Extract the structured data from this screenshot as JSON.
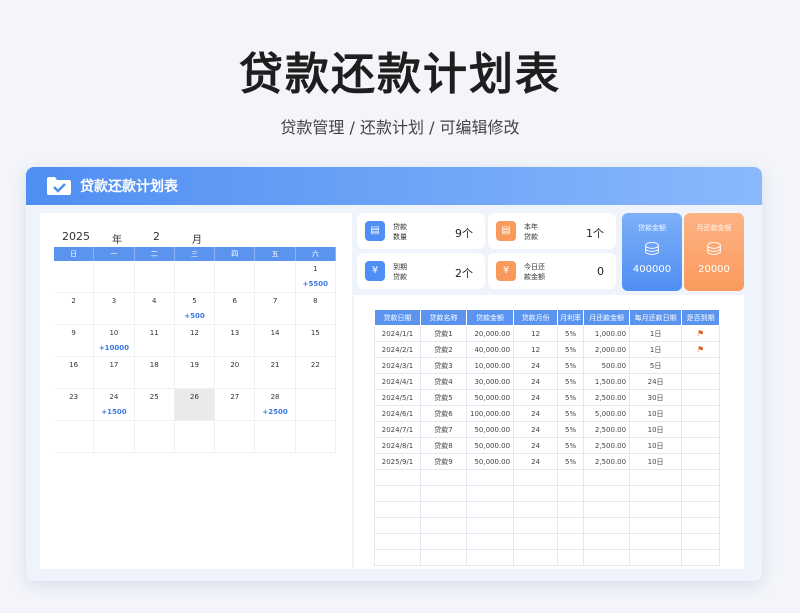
{
  "hero": {
    "title": "贷款还款计划表",
    "subtitle": "贷款管理 / 还款计划 /  可编辑修改"
  },
  "window": {
    "title": "贷款还款计划表",
    "icon": "folder-check-icon"
  },
  "calendar": {
    "year": "2025",
    "year_label": "年",
    "month": "2",
    "month_label": "月",
    "weekdays": [
      "日",
      "一",
      "二",
      "三",
      "四",
      "五",
      "六"
    ],
    "weeks": [
      [
        {
          "d": "",
          "a": ""
        },
        {
          "d": "",
          "a": ""
        },
        {
          "d": "",
          "a": ""
        },
        {
          "d": "",
          "a": ""
        },
        {
          "d": "",
          "a": ""
        },
        {
          "d": "",
          "a": ""
        },
        {
          "d": "1",
          "a": "+5500"
        }
      ],
      [
        {
          "d": "2",
          "a": ""
        },
        {
          "d": "3",
          "a": ""
        },
        {
          "d": "4",
          "a": ""
        },
        {
          "d": "5",
          "a": "+500"
        },
        {
          "d": "6",
          "a": ""
        },
        {
          "d": "7",
          "a": ""
        },
        {
          "d": "8",
          "a": ""
        }
      ],
      [
        {
          "d": "9",
          "a": ""
        },
        {
          "d": "10",
          "a": "+10000"
        },
        {
          "d": "11",
          "a": ""
        },
        {
          "d": "12",
          "a": ""
        },
        {
          "d": "13",
          "a": ""
        },
        {
          "d": "14",
          "a": ""
        },
        {
          "d": "15",
          "a": ""
        }
      ],
      [
        {
          "d": "16",
          "a": ""
        },
        {
          "d": "17",
          "a": ""
        },
        {
          "d": "18",
          "a": ""
        },
        {
          "d": "19",
          "a": ""
        },
        {
          "d": "20",
          "a": ""
        },
        {
          "d": "21",
          "a": ""
        },
        {
          "d": "22",
          "a": ""
        }
      ],
      [
        {
          "d": "23",
          "a": ""
        },
        {
          "d": "24",
          "a": "+1500"
        },
        {
          "d": "25",
          "a": ""
        },
        {
          "d": "26",
          "a": ""
        },
        {
          "d": "27",
          "a": ""
        },
        {
          "d": "28",
          "a": "+2500"
        },
        {
          "d": "",
          "a": ""
        }
      ],
      [
        {
          "d": "",
          "a": ""
        },
        {
          "d": "",
          "a": ""
        },
        {
          "d": "",
          "a": ""
        },
        {
          "d": "",
          "a": ""
        },
        {
          "d": "",
          "a": ""
        },
        {
          "d": "",
          "a": ""
        },
        {
          "d": "",
          "a": ""
        }
      ]
    ],
    "today": "26"
  },
  "stats": {
    "loan_count": {
      "label1": "贷款",
      "label2": "数量",
      "value": "9个",
      "icon": "document-icon"
    },
    "year_loans": {
      "label1": "本年",
      "label2": "贷款",
      "value": "1个",
      "icon": "document-icon"
    },
    "due_loans": {
      "label1": "到期",
      "label2": "贷款",
      "value": "2个",
      "icon": "yen-icon"
    },
    "today_repay": {
      "label1": "今日还",
      "label2": "款金额",
      "value": "0",
      "icon": "yen-icon"
    },
    "loan_amount": {
      "label": "贷款金额",
      "value": "400000",
      "icon": "coins-icon",
      "color": "#4f8ef2"
    },
    "monthly_repay": {
      "label": "月还款金额",
      "value": "20000",
      "icon": "coins-icon",
      "color": "#f99a5c"
    }
  },
  "table": {
    "headers": [
      "贷款日期",
      "贷款名称",
      "贷款金额",
      "贷款月份",
      "月利率",
      "月还款金额",
      "每月还款日期",
      "是否到期"
    ],
    "rows": [
      [
        "2024/1/1",
        "贷款1",
        "20,000.00",
        "12",
        "5%",
        "1,000.00",
        "1日",
        "flag"
      ],
      [
        "2024/2/1",
        "贷款2",
        "40,000.00",
        "12",
        "5%",
        "2,000.00",
        "1日",
        "flag"
      ],
      [
        "2024/3/1",
        "贷款3",
        "10,000.00",
        "24",
        "5%",
        "500.00",
        "5日",
        ""
      ],
      [
        "2024/4/1",
        "贷款4",
        "30,000.00",
        "24",
        "5%",
        "1,500.00",
        "24日",
        ""
      ],
      [
        "2024/5/1",
        "贷款5",
        "50,000.00",
        "24",
        "5%",
        "2,500.00",
        "30日",
        ""
      ],
      [
        "2024/6/1",
        "贷款6",
        "100,000.00",
        "24",
        "5%",
        "5,000.00",
        "10日",
        ""
      ],
      [
        "2024/7/1",
        "贷款7",
        "50,000.00",
        "24",
        "5%",
        "2,500.00",
        "10日",
        ""
      ],
      [
        "2024/8/1",
        "贷款8",
        "50,000.00",
        "24",
        "5%",
        "2,500.00",
        "10日",
        ""
      ],
      [
        "2025/9/1",
        "贷款9",
        "50,000.00",
        "24",
        "5%",
        "2,500.00",
        "10日",
        ""
      ]
    ],
    "empty_rows": 6
  }
}
